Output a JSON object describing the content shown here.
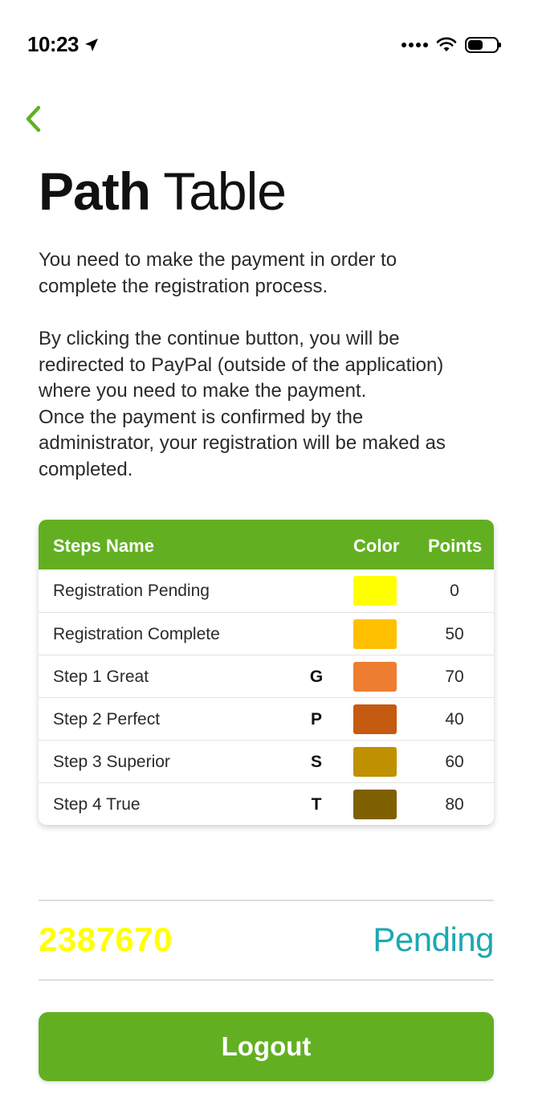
{
  "status_bar": {
    "time": "10:23",
    "location_icon": "location-arrow-icon",
    "signal_icon": "cellular-dots-icon",
    "wifi_icon": "wifi-icon",
    "battery_icon": "battery-icon"
  },
  "nav": {
    "back_icon": "chevron-left-icon",
    "accent_color": "#62b022"
  },
  "title": {
    "bold": "Path",
    "light": "Table"
  },
  "paragraphs": {
    "p1_line1": "You need to make the payment in order to",
    "p1_line2": "complete the registration process.",
    "p2_line1": "By clicking the continue button, you will be",
    "p2_line2": "redirected to PayPal (outside of the application)",
    "p2_line3": "where you need to make the payment.",
    "p2_line4": "Once the payment is confirmed by the",
    "p2_line5": "administrator, your registration will be maked as",
    "p2_line6": "completed."
  },
  "table": {
    "header": {
      "name": "Steps Name",
      "color": "Color",
      "points": "Points"
    },
    "header_bg": "#62b022",
    "rows": [
      {
        "name": "Registration Pending",
        "code": "",
        "color": "#ffff00",
        "points": "0"
      },
      {
        "name": "Registration Complete",
        "code": "",
        "color": "#ffc000",
        "points": "50"
      },
      {
        "name": "Step 1 Great",
        "code": "G",
        "color": "#ed7d31",
        "points": "70"
      },
      {
        "name": "Step 2 Perfect",
        "code": "P",
        "color": "#c55a11",
        "points": "40"
      },
      {
        "name": "Step 3 Superior",
        "code": "S",
        "color": "#bf9000",
        "points": "60"
      },
      {
        "name": "Step 4 True",
        "code": "T",
        "color": "#7f6000",
        "points": "80"
      }
    ]
  },
  "registration": {
    "code": "2387670",
    "code_color": "#ffff00",
    "status": "Pending",
    "status_color": "#1ba9b2"
  },
  "logout": {
    "label": "Logout",
    "bg": "#62b022"
  }
}
